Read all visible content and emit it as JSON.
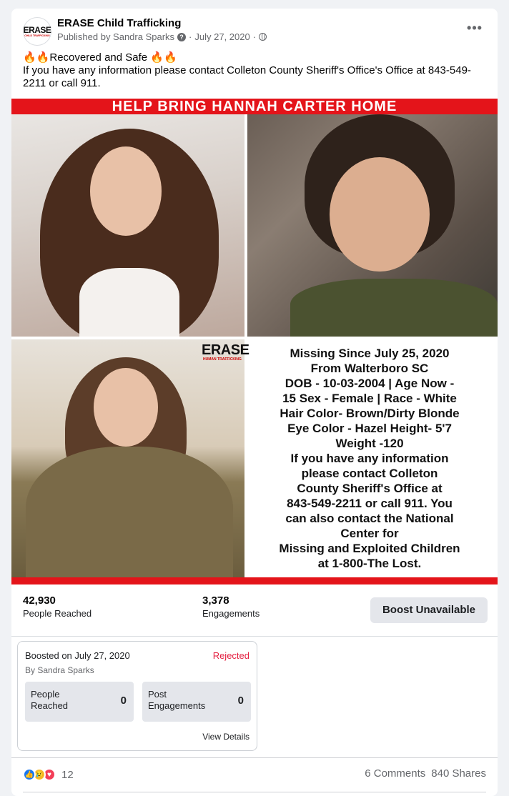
{
  "post": {
    "page_name": "ERASE Child Trafficking",
    "avatar_text": "ERASE",
    "avatar_subtext": "CHILD TRAFFICKING",
    "published_by": "Published by Sandra Sparks",
    "help_glyph": "?",
    "date": "July 27, 2020",
    "separator": "·",
    "more_glyph": "•••",
    "headline": "Recovered and Safe",
    "fire_emoji": "🔥🔥",
    "body": "If you have any information please contact Colleton County Sheriff's Office's Office at 843-549-2211 or call 911."
  },
  "poster": {
    "banner": "HELP BRING HANNAH CARTER HOME",
    "logo_text": "ERASE",
    "logo_subtext": "HUMAN TRAFFICKING",
    "info_lines": [
      "Missing Since July 25, 2020",
      "From Walterboro SC",
      "DOB - 10-03-2004 | Age Now -",
      "15  Sex - Female | Race - White",
      "Hair Color- Brown/Dirty Blonde",
      "Eye Color - Hazel Height- 5'7",
      "Weight -120",
      "If you have any information",
      "please contact Colleton",
      "County Sheriff's Office at",
      "843-549-2211 or call 911. You",
      "can also contact the National",
      "Center for",
      "Missing and Exploited Children",
      "at 1-800-The Lost."
    ]
  },
  "stats": {
    "people_reached_value": "42,930",
    "people_reached_label": "People Reached",
    "engagements_value": "3,378",
    "engagements_label": "Engagements",
    "boost_button": "Boost Unavailable"
  },
  "boost": {
    "date": "Boosted on July 27, 2020",
    "status": "Rejected",
    "by": "By Sandra Sparks",
    "people_reached_label": "People Reached",
    "people_reached_value": "0",
    "post_engagements_label": "Post Engagements",
    "post_engagements_value": "0",
    "view_details": "View Details"
  },
  "footer": {
    "reaction_count": "12",
    "comments": "6 Comments",
    "shares": "840 Shares"
  },
  "colors": {
    "brand_red": "#e4141a",
    "rejected": "#e41e3f",
    "like_blue": "#1877f2"
  }
}
